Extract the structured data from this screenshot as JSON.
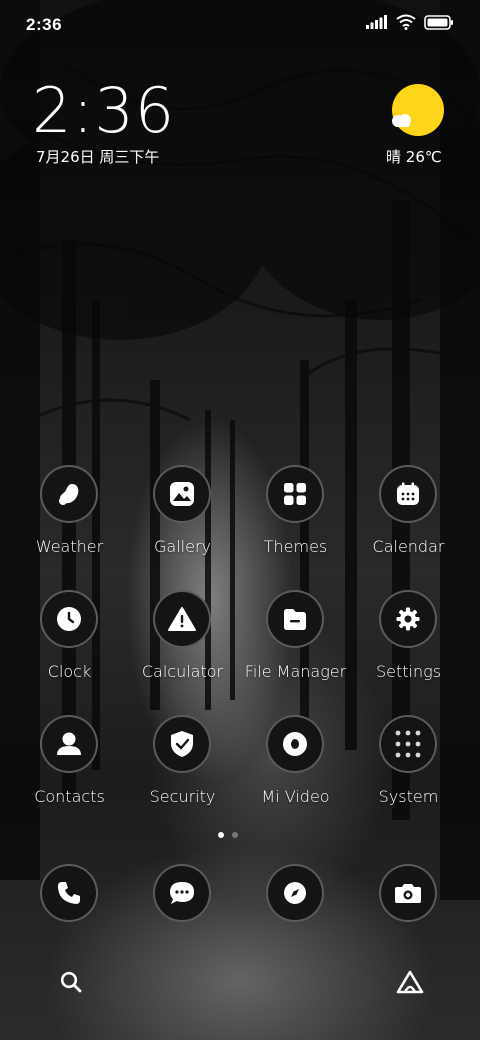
{
  "status_bar": {
    "time": "2:36",
    "icons": [
      "signal-icon",
      "wifi-icon",
      "battery-icon"
    ]
  },
  "lock_clock": {
    "time": "2:36",
    "date": "7月26日 周三下午"
  },
  "weather_widget": {
    "condition": "晴",
    "temperature": "26℃",
    "icon": "sun-cloud-icon",
    "sun_color": "#ffd51a"
  },
  "apps": [
    {
      "label": "Weather",
      "icon": "weather-icon"
    },
    {
      "label": "Gallery",
      "icon": "gallery-icon"
    },
    {
      "label": "Themes",
      "icon": "themes-icon"
    },
    {
      "label": "Calendar",
      "icon": "calendar-icon"
    },
    {
      "label": "Clock",
      "icon": "clock-icon"
    },
    {
      "label": "Calculator",
      "icon": "calculator-icon"
    },
    {
      "label": "File Manager",
      "icon": "file-manager-icon"
    },
    {
      "label": "Settings",
      "icon": "settings-icon"
    },
    {
      "label": "Contacts",
      "icon": "contacts-icon"
    },
    {
      "label": "Security",
      "icon": "security-icon"
    },
    {
      "label": "Mi Video",
      "icon": "mi-video-icon"
    },
    {
      "label": "System",
      "icon": "folder-icon"
    }
  ],
  "pager": {
    "active_page": 1,
    "total_pages": 2
  },
  "dock": [
    {
      "icon": "phone-icon"
    },
    {
      "icon": "messages-icon"
    },
    {
      "icon": "browser-icon"
    },
    {
      "icon": "camera-icon"
    }
  ],
  "bottom_bar": {
    "left_icon": "search-icon",
    "right_icon": "app-vault-icon"
  }
}
